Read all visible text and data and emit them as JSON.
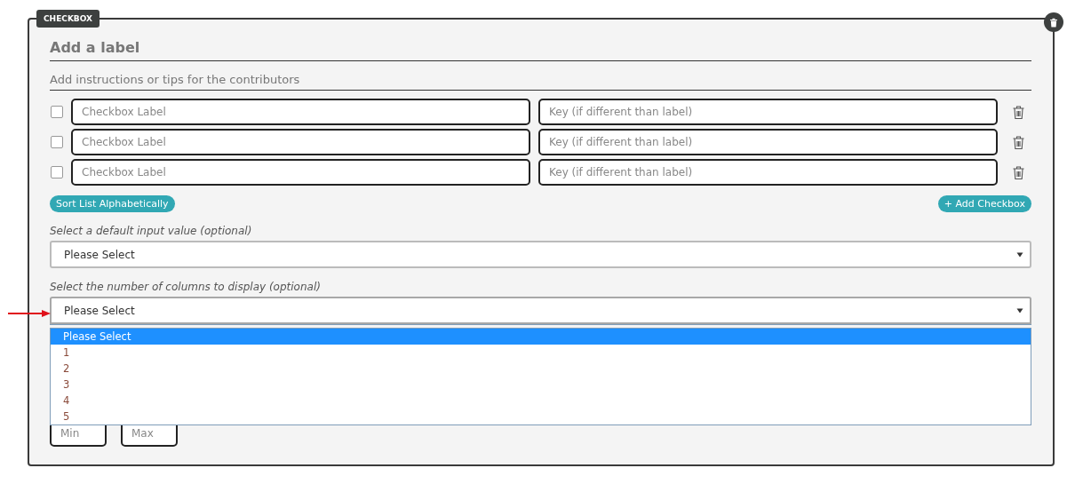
{
  "badge": "CHECKBOX",
  "title": "Add a label",
  "instructions": "Add instructions or tips for the contributors",
  "rows": [
    {
      "checked": false,
      "label_placeholder": "Checkbox Label",
      "key_placeholder": "Key (if different than label)"
    },
    {
      "checked": false,
      "label_placeholder": "Checkbox Label",
      "key_placeholder": "Key (if different than label)"
    },
    {
      "checked": false,
      "label_placeholder": "Checkbox Label",
      "key_placeholder": "Key (if different than label)"
    }
  ],
  "buttons": {
    "sort": "Sort List Alphabetically",
    "add": "+ Add Checkbox"
  },
  "default_select": {
    "label": "Select a default input value (optional)",
    "value": "Please Select"
  },
  "columns_select": {
    "label": "Select the number of columns to display (optional)",
    "value": "Please Select",
    "expanded": true,
    "options": [
      {
        "label": "Please Select",
        "selected": true
      },
      {
        "label": "1",
        "selected": false
      },
      {
        "label": "2",
        "selected": false
      },
      {
        "label": "3",
        "selected": false
      },
      {
        "label": "4",
        "selected": false
      },
      {
        "label": "5",
        "selected": false
      }
    ]
  },
  "range": {
    "min_placeholder": "Min",
    "max_placeholder": "Max"
  }
}
